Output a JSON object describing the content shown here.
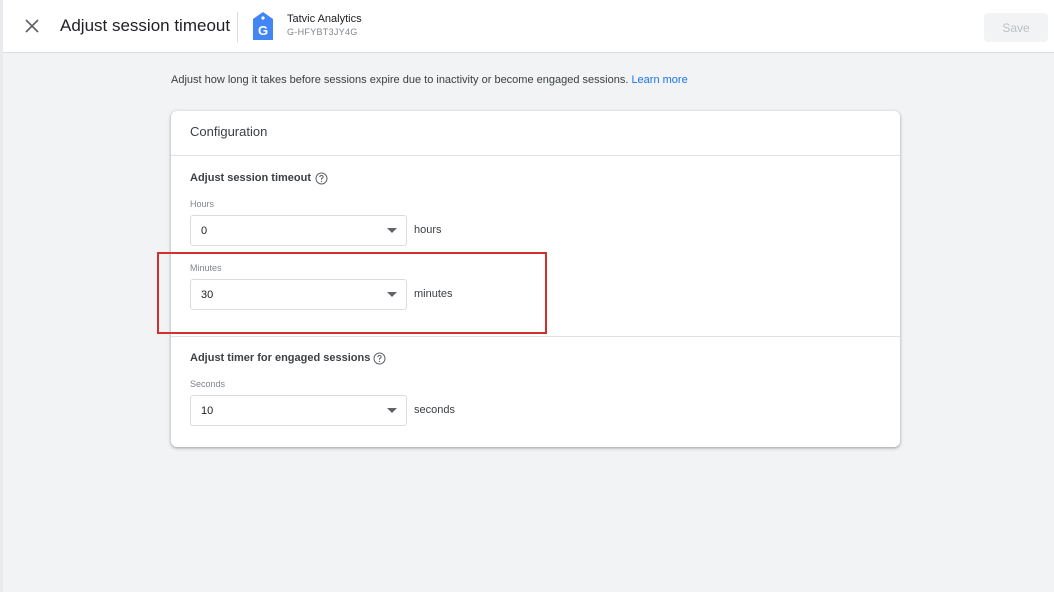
{
  "header": {
    "title": "Adjust session timeout",
    "property_name": "Tatvic Analytics",
    "property_id": "G-HFYBT3JY4G",
    "property_icon_letter": "G",
    "save_label": "Save",
    "close_icon": "close-icon"
  },
  "intro": {
    "text": "Adjust how long it takes before sessions expire due to inactivity or become engaged sessions.",
    "link_label": "Learn more"
  },
  "card": {
    "title": "Configuration",
    "session_timeout": {
      "title": "Adjust session timeout",
      "hours": {
        "label": "Hours",
        "value": "0",
        "unit": "hours"
      },
      "minutes": {
        "label": "Minutes",
        "value": "30",
        "unit": "minutes"
      }
    },
    "engaged_timer": {
      "title": "Adjust timer for engaged sessions",
      "seconds": {
        "label": "Seconds",
        "value": "10",
        "unit": "seconds"
      }
    }
  },
  "colors": {
    "accent": "#1a73e8",
    "highlight": "#d32f2f",
    "property_icon": "#4285f4"
  }
}
